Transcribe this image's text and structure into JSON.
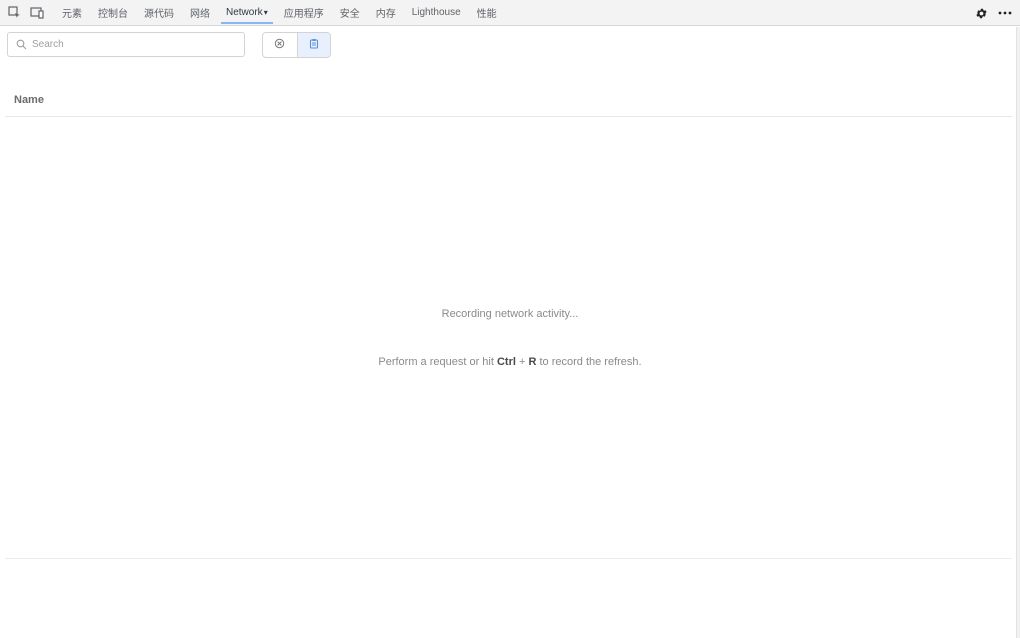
{
  "tabbar": {
    "left_icons": [
      "inspect-element-icon",
      "device-toolbar-icon"
    ],
    "tabs": [
      {
        "label": "元素",
        "active": false
      },
      {
        "label": "控制台",
        "active": false
      },
      {
        "label": "源代码",
        "active": false
      },
      {
        "label": "网络",
        "active": false
      },
      {
        "label": "Network",
        "active": true
      },
      {
        "label": "应用程序",
        "active": false
      },
      {
        "label": "安全",
        "active": false
      },
      {
        "label": "内存",
        "active": false
      },
      {
        "label": "Lighthouse",
        "active": false
      },
      {
        "label": "性能",
        "active": false
      }
    ],
    "active_tab_suffix": "▾",
    "right_icons": [
      "settings-gear-icon",
      "more-options-icon"
    ]
  },
  "toolbar": {
    "search": {
      "placeholder": "Search",
      "value": ""
    },
    "buttons": [
      "clear-icon",
      "preserve-log-icon"
    ]
  },
  "table": {
    "columns": [
      "Name"
    ]
  },
  "empty_state": {
    "line1": "Recording network activity...",
    "line2_prefix": "Perform a request or hit ",
    "key1": "Ctrl",
    "plus": " + ",
    "key2": "R",
    "line2_suffix": " to record the refresh."
  },
  "colors": {
    "active_tab_underline": "#8ab4f8",
    "pressed_button_bg": "#e8f0fe"
  }
}
